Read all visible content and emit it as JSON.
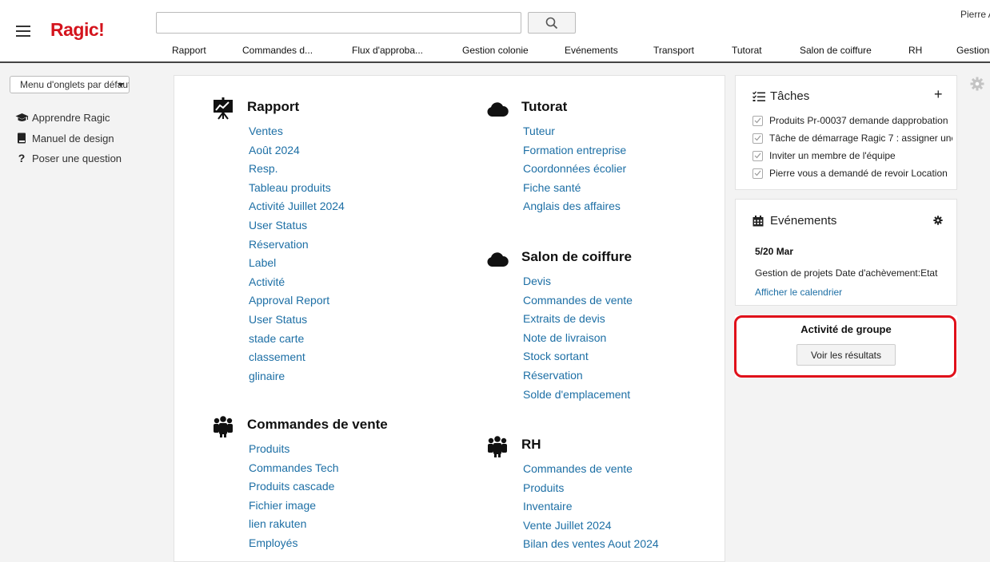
{
  "header": {
    "logo": "Ragic!",
    "search_placeholder": "",
    "user_name": "Pierre A",
    "tabs": [
      {
        "label": "Rapport"
      },
      {
        "label": "Commandes d..."
      },
      {
        "label": "Flux d'approba..."
      },
      {
        "label": "Gestion colonie"
      },
      {
        "label": "Evénements"
      },
      {
        "label": "Transport"
      },
      {
        "label": "Tutorat"
      },
      {
        "label": "Salon de coiffure"
      },
      {
        "label": "RH"
      },
      {
        "label": "Gestion"
      }
    ]
  },
  "sidebar": {
    "tab_menu_label": "Menu d'onglets par défaut",
    "links": [
      {
        "label": "Apprendre Ragic",
        "icon": "graduation-cap-icon"
      },
      {
        "label": "Manuel de design",
        "icon": "book-icon"
      },
      {
        "label": "Poser une question",
        "icon": "question-mark-icon"
      }
    ]
  },
  "sections": [
    {
      "title": "Rapport",
      "icon": "presentation-chart-icon",
      "links": [
        "Ventes",
        "Août 2024",
        "Resp.",
        "Tableau produits",
        "Activité Juillet 2024",
        "User Status",
        "Réservation",
        "Label",
        "Activité",
        "Approval Report",
        "User Status",
        "stade carte",
        "classement",
        "glinaire"
      ]
    },
    {
      "title": "Commandes de vente",
      "icon": "group-icon",
      "links": [
        "Produits",
        "Commandes Tech",
        "Produits cascade",
        "Fichier image",
        "lien rakuten",
        "Employés"
      ]
    },
    {
      "title": "Tutorat",
      "icon": "cloud-icon",
      "links": [
        "Tuteur",
        "Formation entreprise",
        "Coordonnées écolier",
        "Fiche santé",
        "Anglais des affaires"
      ]
    },
    {
      "title": "Salon de coiffure",
      "icon": "cloud-icon",
      "links": [
        "Devis",
        "Commandes de vente",
        "Extraits de devis",
        "Note de livraison",
        "Stock sortant",
        "Réservation",
        "Solde d'emplacement"
      ]
    },
    {
      "title": "RH",
      "icon": "group-icon",
      "links": [
        "Commandes de vente",
        "Produits",
        "Inventaire",
        "Vente Juillet 2024",
        "Bilan des ventes Aout 2024"
      ]
    }
  ],
  "tasks": {
    "title": "Tâches",
    "add_label": "+",
    "items": [
      "Produits Pr-00037 demande dapprobation",
      "Tâche de démarrage Ragic 7 : assigner une",
      "Inviter un membre de l'équipe",
      "Pierre vous a demandé de revoir Location"
    ]
  },
  "events": {
    "title": "Evénements",
    "date": "5/20 Mar",
    "entry": "Gestion de projets Date d'achèvement:Etat",
    "calendar_link": "Afficher le calendrier"
  },
  "group_activity": {
    "title": "Activité de groupe",
    "button_label": "Voir les résultats"
  },
  "colors": {
    "brand": "#d4141d",
    "link": "#1d6fa5",
    "highlight": "#e0101a"
  }
}
